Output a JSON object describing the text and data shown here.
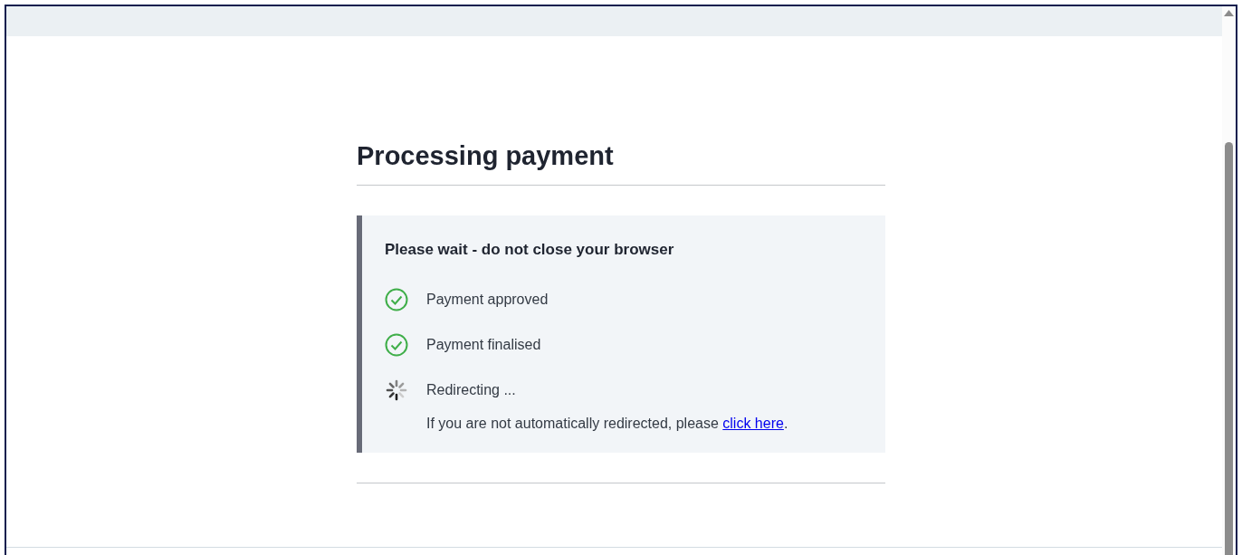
{
  "heading": "Processing payment",
  "panel": {
    "title": "Please wait - do not close your browser",
    "steps": [
      {
        "kind": "done",
        "label": "Payment approved"
      },
      {
        "kind": "done",
        "label": "Payment finalised"
      },
      {
        "kind": "loading",
        "label": "Redirecting ...",
        "note": {
          "text": "If you are not automatically redirected, please ",
          "link": "click here",
          "after": "."
        }
      }
    ]
  }
}
